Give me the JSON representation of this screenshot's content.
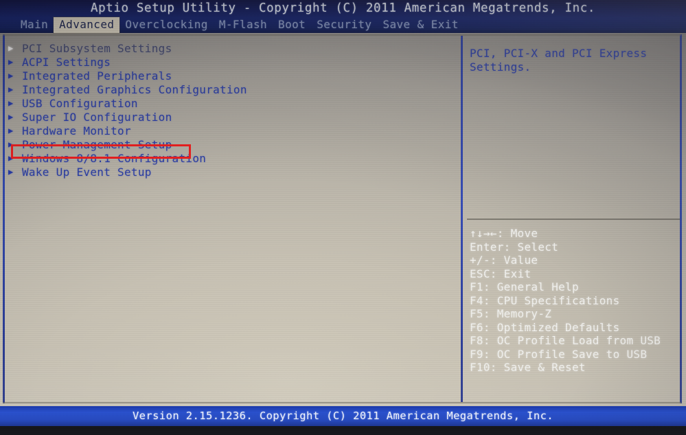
{
  "titlebar": {
    "title": "Aptio Setup Utility - Copyright (C) 2011 American Megatrends, Inc."
  },
  "tabs": [
    {
      "label": "Main",
      "active": false
    },
    {
      "label": "Advanced",
      "active": true
    },
    {
      "label": "Overclocking",
      "active": false
    },
    {
      "label": "M-Flash",
      "active": false
    },
    {
      "label": "Boot",
      "active": false
    },
    {
      "label": "Security",
      "active": false
    },
    {
      "label": "Save & Exit",
      "active": false
    }
  ],
  "menu": {
    "arrow_glyph": "▶",
    "items": [
      {
        "label": "PCI Subsystem Settings",
        "selected": true,
        "highlighted": false
      },
      {
        "label": "ACPI Settings",
        "selected": false,
        "highlighted": false
      },
      {
        "label": "Integrated Peripherals",
        "selected": false,
        "highlighted": false
      },
      {
        "label": "Integrated Graphics Configuration",
        "selected": false,
        "highlighted": false
      },
      {
        "label": "USB Configuration",
        "selected": false,
        "highlighted": false
      },
      {
        "label": "Super IO Configuration",
        "selected": false,
        "highlighted": false
      },
      {
        "label": "Hardware Monitor",
        "selected": false,
        "highlighted": false
      },
      {
        "label": "Power Management Setup",
        "selected": false,
        "highlighted": true
      },
      {
        "label": "Windows 8/8.1 Configuration",
        "selected": false,
        "highlighted": false
      },
      {
        "label": "Wake Up Event Setup",
        "selected": false,
        "highlighted": false
      }
    ]
  },
  "annotation": {
    "color": "#ee2020",
    "target_label": "Power Management Setup"
  },
  "help": {
    "text": "PCI, PCI-X and PCI Express\nSettings."
  },
  "keys": [
    {
      "label": "↑↓→←: Move"
    },
    {
      "label": "Enter: Select"
    },
    {
      "label": "+/-: Value"
    },
    {
      "label": "ESC: Exit"
    },
    {
      "label": "F1: General Help"
    },
    {
      "label": "F4: CPU Specifications"
    },
    {
      "label": "F5: Memory-Z"
    },
    {
      "label": "F6: Optimized Defaults"
    },
    {
      "label": "F8: OC Profile Load from USB"
    },
    {
      "label": "F9: OC Profile Save to USB"
    },
    {
      "label": "F10: Save & Reset"
    }
  ],
  "footer": {
    "version": "Version 2.15.1236. Copyright (C) 2011 American Megatrends, Inc."
  },
  "colors": {
    "title_band": "#16246d",
    "footer_band": "#1a40bd",
    "menu_text": "#2d3fa6",
    "help_text": "#2f41a8",
    "key_text": "#f2f2ef",
    "active_tab_bg": "#d9d2c0",
    "active_tab_text": "#1c2550",
    "inactive_tab_text": "#8f9ec4",
    "screen_bg": "#c9c3b5",
    "annotation": "#ee2020"
  }
}
